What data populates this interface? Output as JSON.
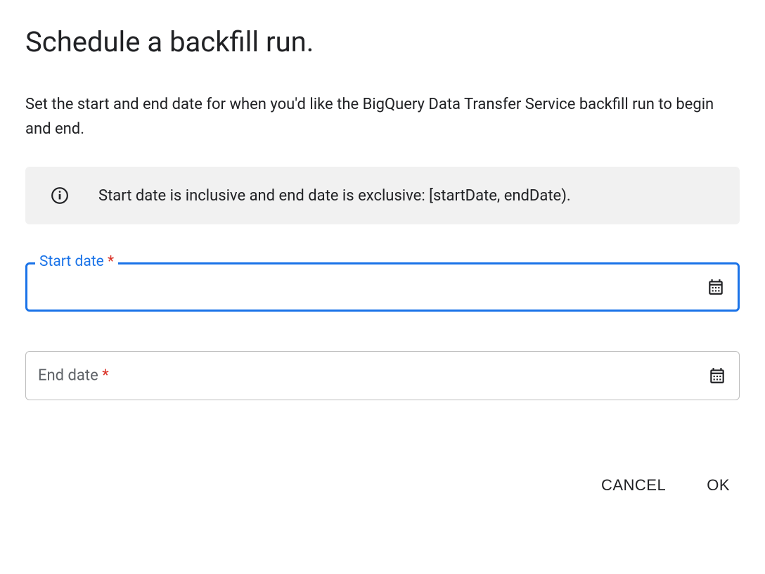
{
  "dialog": {
    "title": "Schedule a backfill run.",
    "description": "Set the start and end date for when you'd like the BigQuery Data Transfer Service backfill run to begin and end.",
    "info_text": "Start date is inclusive and end date is exclusive: [startDate, endDate)."
  },
  "fields": {
    "start_date": {
      "label": "Start date",
      "value": ""
    },
    "end_date": {
      "label": "End date",
      "value": ""
    }
  },
  "actions": {
    "cancel": "CANCEL",
    "ok": "OK"
  }
}
